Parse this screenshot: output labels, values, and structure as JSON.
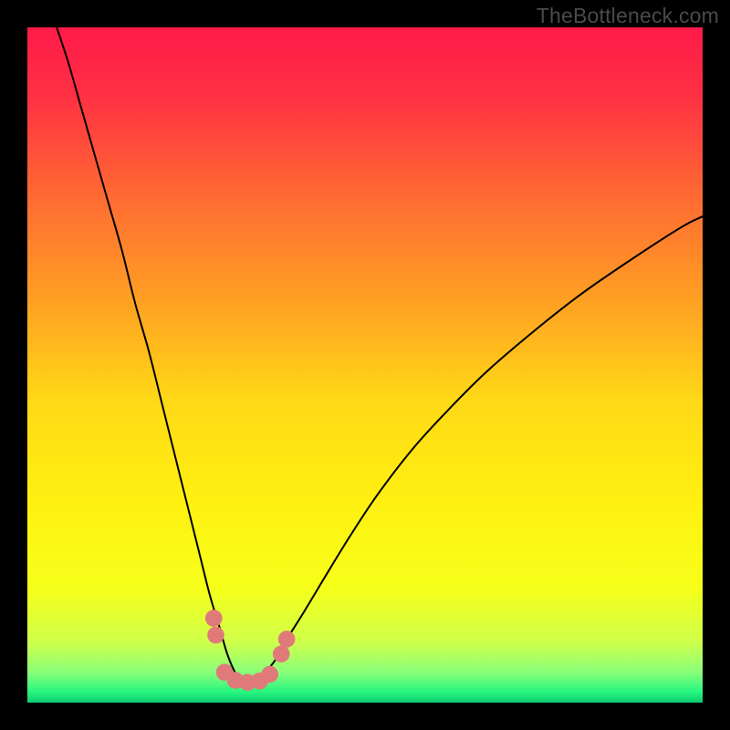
{
  "watermark": "TheBottleneck.com",
  "chart_data": {
    "type": "line",
    "title": "",
    "xlabel": "",
    "ylabel": "",
    "xlim": [
      0,
      100
    ],
    "ylim": [
      0,
      100
    ],
    "background_stops": [
      {
        "offset": 0.0,
        "color": "#ff1a49"
      },
      {
        "offset": 0.1,
        "color": "#ff3043"
      },
      {
        "offset": 0.25,
        "color": "#ff6a33"
      },
      {
        "offset": 0.4,
        "color": "#ff9e23"
      },
      {
        "offset": 0.55,
        "color": "#ffd816"
      },
      {
        "offset": 0.7,
        "color": "#fff011"
      },
      {
        "offset": 0.83,
        "color": "#f6ff19"
      },
      {
        "offset": 0.91,
        "color": "#cfff4a"
      },
      {
        "offset": 0.955,
        "color": "#8aff7a"
      },
      {
        "offset": 0.985,
        "color": "#25f57f"
      },
      {
        "offset": 1.0,
        "color": "#0cc96f"
      }
    ],
    "series": [
      {
        "name": "bottleneck-curve",
        "color": "#000000",
        "width": 2,
        "x": [
          4,
          6,
          8,
          10,
          12,
          14,
          16,
          18,
          20,
          22,
          24,
          25.5,
          27,
          28.5,
          29.5,
          30.5,
          31.5,
          33,
          34.5,
          36.5,
          38.5,
          41,
          44,
          48,
          52,
          57,
          62,
          68,
          75,
          82,
          90,
          97,
          100
        ],
        "y": [
          101,
          95,
          88,
          81,
          74,
          67,
          59,
          52,
          44,
          36,
          28,
          22,
          16,
          11,
          7.5,
          5,
          3.5,
          3.3,
          3.9,
          6,
          9.5,
          13.5,
          18.5,
          25,
          31,
          37.5,
          43,
          49,
          55,
          60.5,
          66,
          70.5,
          72
        ]
      }
    ],
    "markers": {
      "name": "bottleneck-markers",
      "color": "#e07a7a",
      "radius": 9.3,
      "points": [
        {
          "x": 27.6,
          "y": 12.5
        },
        {
          "x": 27.9,
          "y": 10.0
        },
        {
          "x": 29.2,
          "y": 4.5
        },
        {
          "x": 30.8,
          "y": 3.3
        },
        {
          "x": 32.6,
          "y": 3.0
        },
        {
          "x": 34.4,
          "y": 3.2
        },
        {
          "x": 35.9,
          "y": 4.2
        },
        {
          "x": 37.6,
          "y": 7.2
        },
        {
          "x": 38.4,
          "y": 9.4
        }
      ]
    }
  }
}
